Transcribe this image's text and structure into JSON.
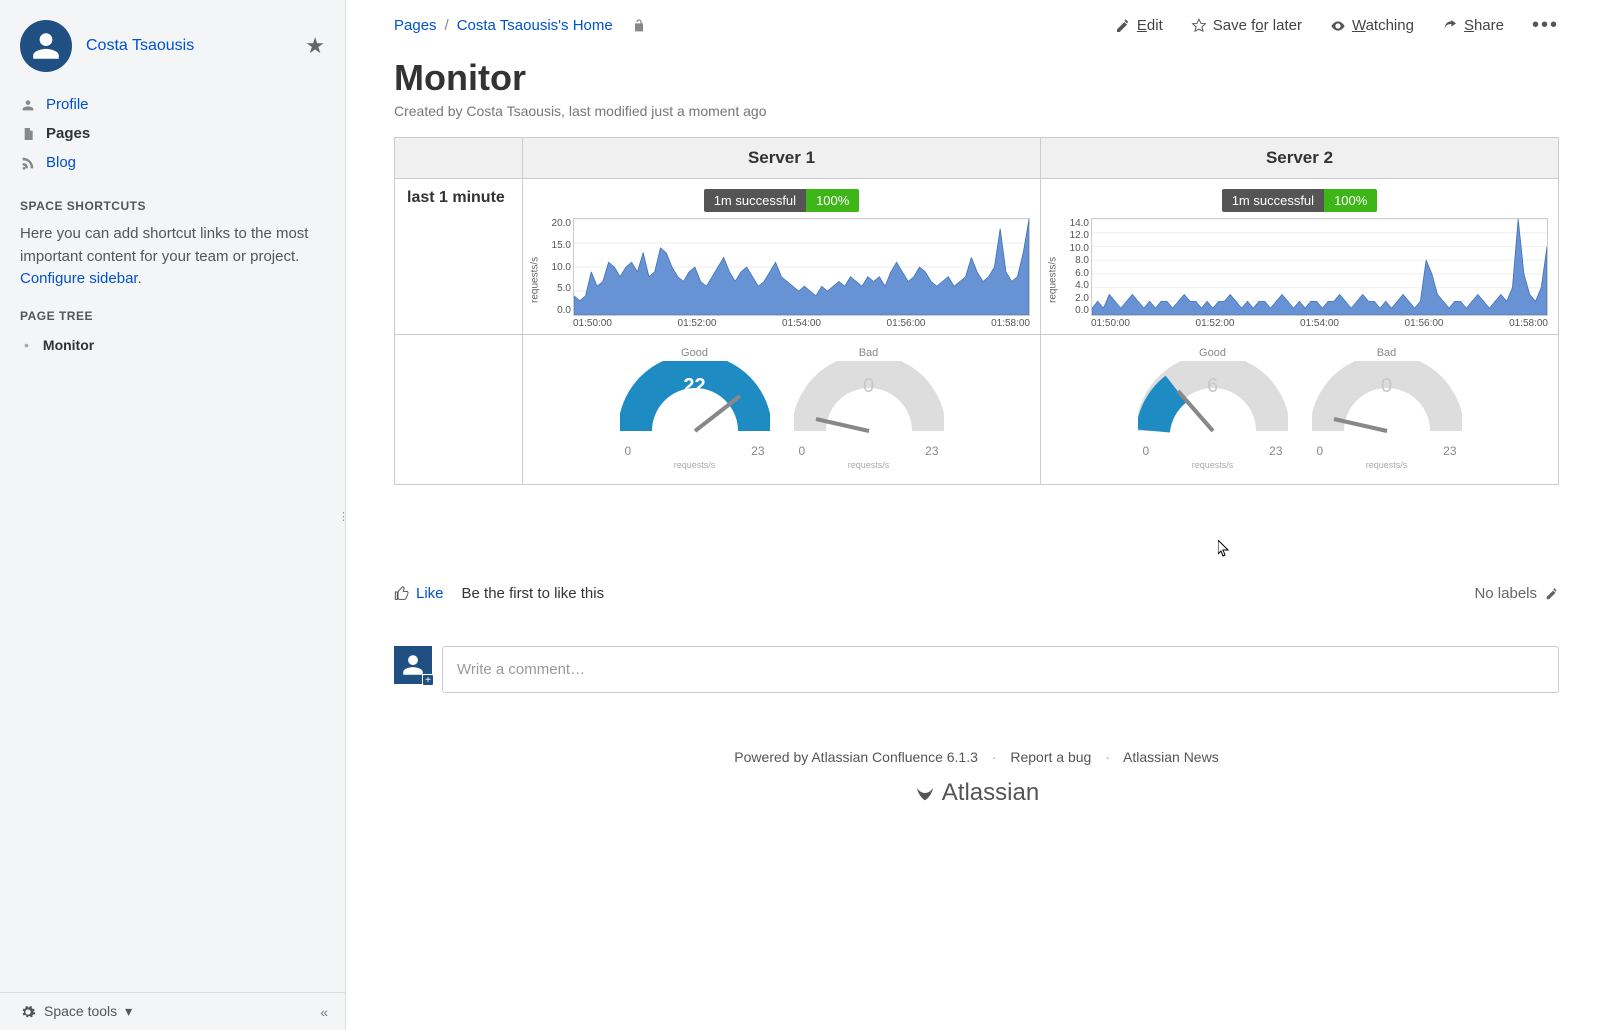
{
  "sidebar": {
    "space_name": "Costa Tsaousis",
    "nav": {
      "profile": "Profile",
      "pages": "Pages",
      "blog": "Blog"
    },
    "shortcuts_title": "SPACE SHORTCUTS",
    "shortcuts_text_1": "Here you can add shortcut links to the most important content for your team or project. ",
    "shortcuts_link": "Configure sidebar",
    "shortcuts_text_2": ".",
    "page_tree_title": "PAGE TREE",
    "page_tree_item": "Monitor",
    "footer_label": "Space tools"
  },
  "breadcrumb": {
    "root": "Pages",
    "page": "Costa Tsaousis's Home"
  },
  "actions": {
    "edit": "Edit",
    "save": "Save for later",
    "watching": "Watching",
    "share": "Share"
  },
  "page": {
    "title": "Monitor",
    "byline": "Created by Costa Tsaousis, last modified just a moment ago"
  },
  "table": {
    "row_label": "last 1 minute",
    "col1": "Server 1",
    "col2": "Server 2"
  },
  "badges": {
    "s1_label": "1m successful",
    "s1_pct": "100%",
    "s2_label": "1m successful",
    "s2_pct": "100%"
  },
  "gauges": {
    "good_label": "Good",
    "bad_label": "Bad",
    "unit": "requests/s",
    "s1_good": "22",
    "s1_bad": "0",
    "s2_good": "6",
    "s2_bad": "0",
    "min": "0",
    "max": "23"
  },
  "likes": {
    "like": "Like",
    "be_first": "Be the first to like this",
    "no_labels": "No labels"
  },
  "comment_placeholder": "Write a comment…",
  "footer": {
    "powered": "Powered by Atlassian Confluence 6.1.3",
    "bug": "Report a bug",
    "news": "Atlassian News",
    "brand": "Atlassian"
  },
  "chart_data": [
    {
      "type": "area",
      "title": "Server 1 — last 1 minute",
      "ylabel": "requests/s",
      "ylim": [
        0,
        20
      ],
      "yticks": [
        "20.0",
        "15.0",
        "10.0",
        "5.0",
        "0.0"
      ],
      "xticks": [
        "01:50:00",
        "01:52:00",
        "01:54:00",
        "01:56:00",
        "01:58:00"
      ],
      "values": [
        4,
        3,
        4,
        9,
        6,
        7,
        11,
        10,
        8,
        10,
        11,
        9,
        13,
        8,
        9,
        14,
        13,
        10,
        8,
        7,
        9,
        10,
        7,
        6,
        8,
        10,
        12,
        9,
        7,
        9,
        10,
        8,
        6,
        7,
        9,
        11,
        8,
        7,
        6,
        5,
        6,
        5,
        4,
        6,
        5,
        6,
        7,
        6,
        8,
        7,
        6,
        8,
        7,
        8,
        6,
        9,
        11,
        9,
        7,
        8,
        10,
        9,
        7,
        6,
        7,
        8,
        6,
        7,
        8,
        12,
        9,
        7,
        8,
        10,
        18,
        9,
        7,
        8,
        13,
        20
      ]
    },
    {
      "type": "area",
      "title": "Server 2 — last 1 minute",
      "ylabel": "requests/s",
      "ylim": [
        0,
        14
      ],
      "yticks": [
        "14.0",
        "12.0",
        "10.0",
        "8.0",
        "6.0",
        "4.0",
        "2.0",
        "0.0"
      ],
      "xticks": [
        "01:50:00",
        "01:52:00",
        "01:54:00",
        "01:56:00",
        "01:58:00"
      ],
      "values": [
        1,
        2,
        1,
        3,
        2,
        1,
        2,
        3,
        2,
        1,
        2,
        1,
        2,
        2,
        1,
        2,
        3,
        2,
        2,
        1,
        2,
        1,
        2,
        2,
        3,
        2,
        1,
        2,
        1,
        2,
        2,
        1,
        2,
        3,
        2,
        1,
        2,
        1,
        2,
        2,
        1,
        2,
        2,
        3,
        2,
        1,
        2,
        3,
        2,
        2,
        1,
        2,
        1,
        2,
        3,
        2,
        1,
        2,
        8,
        6,
        3,
        2,
        1,
        2,
        2,
        1,
        2,
        3,
        2,
        1,
        2,
        3,
        2,
        4,
        14,
        6,
        3,
        2,
        4,
        10
      ]
    }
  ]
}
